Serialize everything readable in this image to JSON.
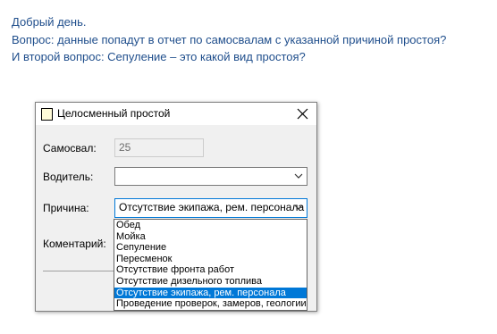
{
  "message": {
    "line1": "Добрый день.",
    "line2": "Вопрос: данные попадут в отчет по самосвалам с указанной причиной простоя?",
    "line3": "И второй вопрос: Сепуление – это  какой вид простоя?"
  },
  "dialog": {
    "title": "Целосменный простой",
    "fields": {
      "dump_truck_label": "Самосвал:",
      "dump_truck_value": "25",
      "driver_label": "Водитель:",
      "driver_value": "",
      "reason_label": "Причина:",
      "reason_value": "Отсутствие экипажа, рем. персонала",
      "comment_label": "Коментарий:"
    },
    "reason_options": [
      "Обед",
      "Мойка",
      "Сепуление",
      "Пересменок",
      "Отсутствие фронта работ",
      "Отсутствие дизельного топлива",
      "Отсутствие экипажа, рем. персонала",
      "Проведение проверок, замеров, геологии"
    ],
    "selected_reason_index": 6
  },
  "colors": {
    "message_text": "#1f4e8c",
    "selection": "#0078d7",
    "dialog_bg": "#f0f0f0"
  },
  "icons": {
    "title_icon": "window-app-icon",
    "close": "close-icon",
    "combo_arrow": "chevron-down-icon"
  }
}
